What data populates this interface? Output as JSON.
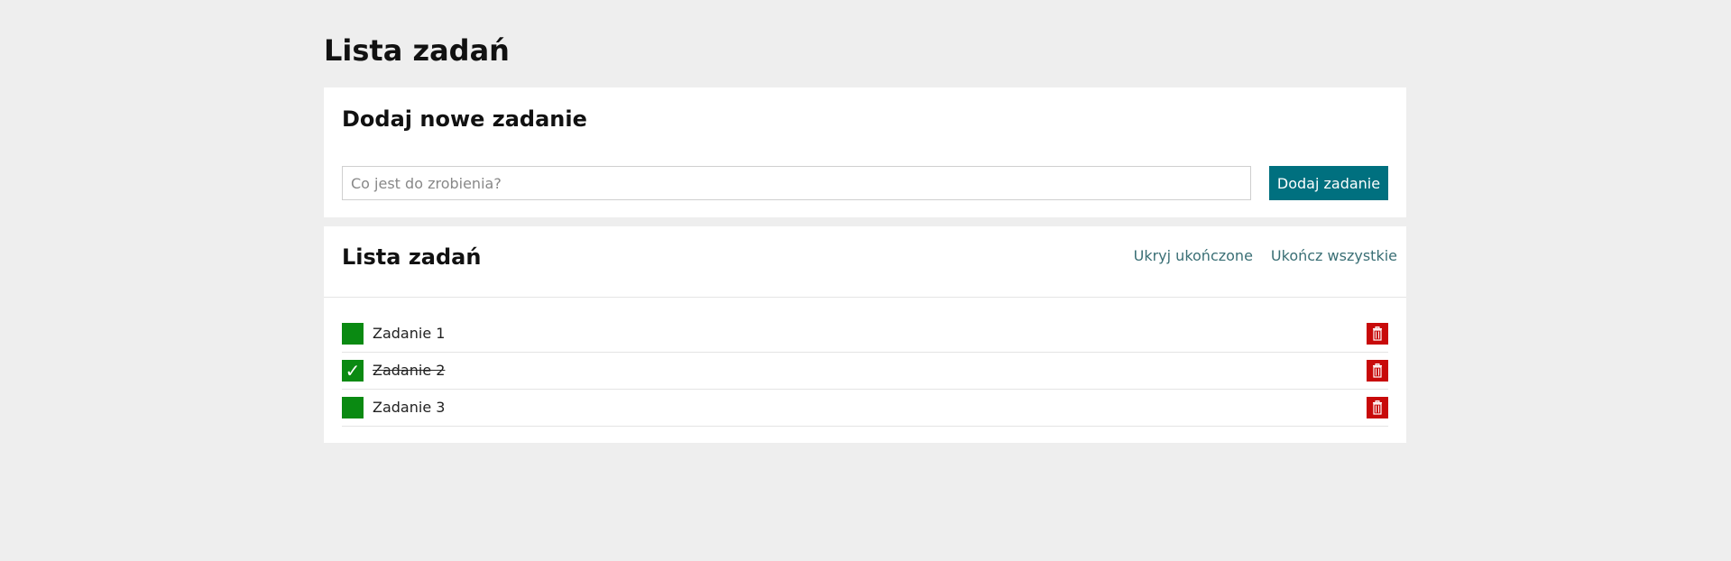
{
  "page": {
    "title": "Lista zadań"
  },
  "add_section": {
    "title": "Dodaj nowe zadanie",
    "input_placeholder": "Co jest do zrobienia?",
    "input_value": "",
    "add_button_label": "Dodaj zadanie"
  },
  "list_section": {
    "title": "Lista zadań",
    "hide_completed_label": "Ukryj ukończone",
    "complete_all_label": "Ukończ wszystkie",
    "tasks": [
      {
        "label": "Zadanie 1",
        "completed": false
      },
      {
        "label": "Zadanie 2",
        "completed": true
      },
      {
        "label": "Zadanie 3",
        "completed": false
      }
    ]
  },
  "icons": {
    "checkmark": "check-icon",
    "delete": "trash-icon"
  },
  "colors": {
    "background": "#eeeeee",
    "card": "#ffffff",
    "primary_button": "#00707f",
    "link": "#3a6f75",
    "checkbox": "#0a8a12",
    "delete": "#c80a0a"
  }
}
